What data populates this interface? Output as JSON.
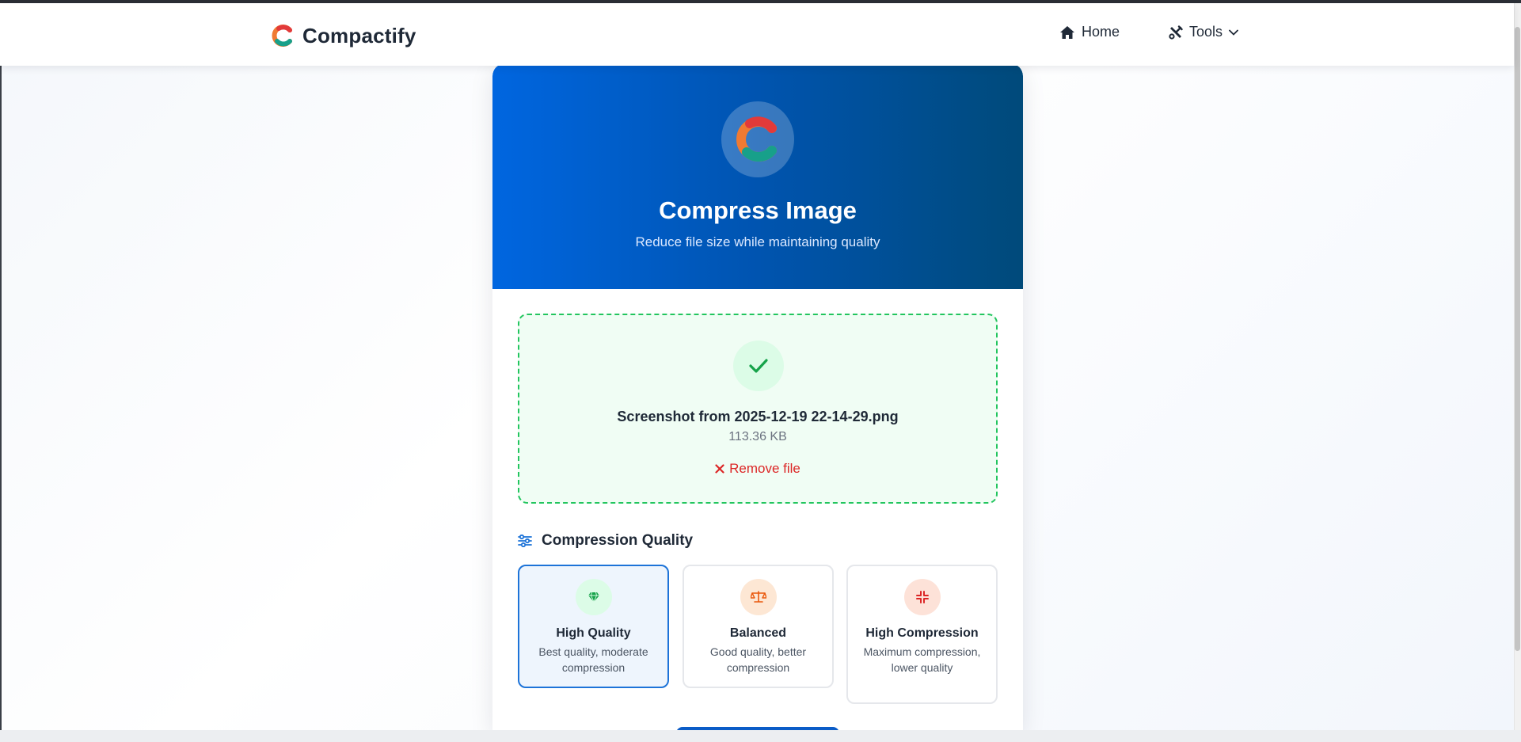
{
  "brand": {
    "name": "Compactify",
    "logo_icon": "compactify-logo-icon"
  },
  "nav": {
    "home_label": "Home",
    "home_icon": "home-icon",
    "tools_label": "Tools",
    "tools_icon": "tools-icon",
    "tools_dropdown_icon": "chevron-down-icon"
  },
  "hero": {
    "title": "Compress Image",
    "subtitle": "Reduce file size while maintaining quality"
  },
  "file": {
    "name": "Screenshot from 2025-12-19 22-14-29.png",
    "size": "113.36 KB",
    "remove_label": "Remove file",
    "status_icon": "check-icon"
  },
  "compression": {
    "section_title": "Compression Quality",
    "section_icon": "sliders-icon",
    "selected": "High Quality",
    "options": [
      {
        "title": "High Quality",
        "description": "Best quality, moderate compression",
        "icon": "gem-icon"
      },
      {
        "title": "Balanced",
        "description": "Good quality, better compression",
        "icon": "scale-icon"
      },
      {
        "title": "High Compression",
        "description": "Maximum compression, lower quality",
        "icon": "compress-icon"
      }
    ]
  },
  "colors": {
    "accent": "#1d73d8",
    "hero_gradient_start": "#0066e0",
    "hero_gradient_end": "#004a7a",
    "success": "#22c55e",
    "danger": "#dc2626",
    "balanced_orange": "#ea580c"
  }
}
